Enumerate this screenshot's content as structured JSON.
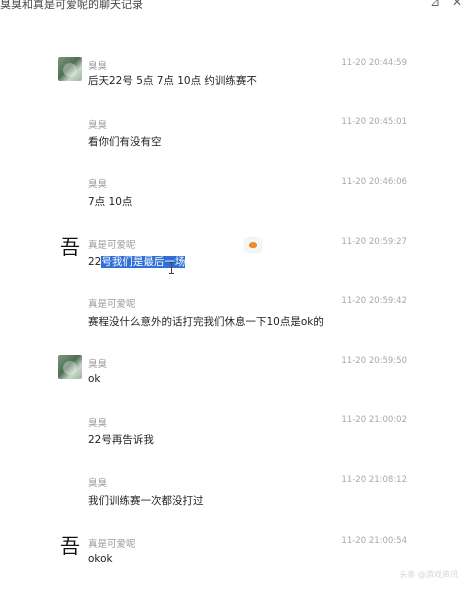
{
  "window": {
    "title": "臭臭和真是可爱呢的聊天记录",
    "pin_glyph": "⊿",
    "close_glyph": "✕"
  },
  "messages": [
    {
      "avatar": "photo-avatar",
      "sender": "臭臭",
      "time": "11-20 20:44:59",
      "text": "后天22号 5点 7点 10点 约训练赛不"
    },
    {
      "avatar": "",
      "sender": "臭臭",
      "time": "11-20 20:45:01",
      "text": "看你们有没有空"
    },
    {
      "avatar": "",
      "sender": "臭臭",
      "time": "11-20 20:46:06",
      "text": "7点 10点"
    },
    {
      "avatar": "sketch-avatar",
      "sender": "真是可爱呢",
      "time": "11-20 20:59:27",
      "text_prefix": "22",
      "text_highlight": "号我们是最后一场"
    },
    {
      "avatar": "",
      "sender": "真是可爱呢",
      "time": "11-20 20:59:42",
      "text": "赛程没什么意外的话打完我们休息一下10点是ok的"
    },
    {
      "avatar": "photo-avatar",
      "sender": "臭臭",
      "time": "11-20 20:59:50",
      "text": "ok"
    },
    {
      "avatar": "",
      "sender": "臭臭",
      "time": "11-20 21:00:02",
      "text": "22号再告诉我"
    },
    {
      "avatar": "",
      "sender": "臭臭",
      "time": "11-20 21:08:12",
      "text": "我们训练赛一次都没打过"
    },
    {
      "avatar": "sketch-avatar",
      "sender": "真是可爱呢",
      "time": "11-20 21:00:54",
      "text": "okok"
    }
  ],
  "sketch_avatar_glyph": "吾",
  "watermark": "头条 @游戏资讯"
}
